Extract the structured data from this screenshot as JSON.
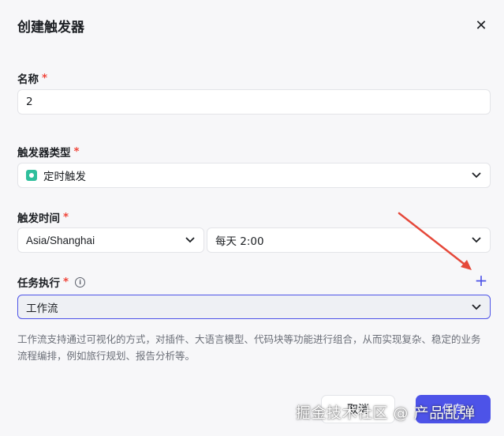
{
  "dialog": {
    "title": "创建触发器",
    "close_icon": "close-icon"
  },
  "name_field": {
    "label": "名称",
    "required_mark": "*",
    "value": "2"
  },
  "trigger_type": {
    "label": "触发器类型",
    "required_mark": "*",
    "icon": "clock-icon",
    "icon_color": "#2fbf9c",
    "selected": "定时触发"
  },
  "trigger_time": {
    "label": "触发时间",
    "required_mark": "*",
    "timezone": "Asia/Shanghai",
    "schedule": "每天 2:00"
  },
  "task": {
    "label": "任务执行",
    "required_mark": "*",
    "info_icon": "info-icon",
    "add_icon": "plus-icon",
    "selected": "工作流",
    "description": "工作流支持通过可视化的方式，对插件、大语言模型、代码块等功能进行组合，从而实现复杂、稳定的业务流程编排，例如旅行规划、报告分析等。"
  },
  "footer": {
    "cancel_label": "取消",
    "save_label": "保存"
  },
  "watermark": "掘金技术社区 @ 产品乱弹",
  "colors": {
    "accent": "#4d53e8",
    "required": "#f0463a",
    "annotation_arrow": "#e5483a"
  }
}
